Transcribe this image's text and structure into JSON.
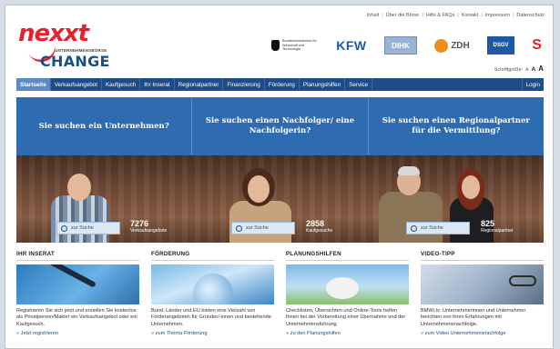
{
  "logo": {
    "brand_main": "nexxt",
    "brand_sub": "UNTERNEHMENSBÖRSE",
    "brand_second": "CHANGE"
  },
  "meta_links": [
    "Inhalt",
    "Über die Börse",
    "Hilfe & FAQs",
    "Kontakt",
    "Impressum",
    "Datenschutz"
  ],
  "partners": {
    "bmwi": "Bundesministerium für Wirtschaft und Technologie",
    "kfw": "KFW",
    "dihk": "DIHK",
    "zdh": "ZDH",
    "dsgv": "DSGV",
    "sparkasse": "S"
  },
  "font_size": {
    "label": "Schriftgröße:",
    "options": [
      "A",
      "A",
      "A"
    ]
  },
  "nav": {
    "items": [
      "Startseite",
      "Verkaufsangebot",
      "Kaufgesuch",
      "Ihr Inserat",
      "Regionalpartner",
      "Finanzierung",
      "Förderung",
      "Planungshilfen",
      "Service"
    ],
    "login": "Login"
  },
  "hero": {
    "tabs": [
      "Sie suchen ein Unternehmen?",
      "Sie suchen einen Nachfolger/ eine Nachfolgerin?",
      "Sie suchen einen Regionalpartner für die Vermittlung?"
    ],
    "search_label": "zur Suche",
    "stats": [
      {
        "number": "7276",
        "label": "Verkaufsangebote"
      },
      {
        "number": "2858",
        "label": "Kaufgesuche"
      },
      {
        "number": "825",
        "label": "Regionalpartner"
      }
    ]
  },
  "teasers": [
    {
      "title": "Ihr Inserat",
      "text": "Registrieren Sie sich jetzt und erstellen Sie kostenlos als Privatperson/Makler ein Verkaufsangebot oder ein Kaufgesuch.",
      "link": "» Jetzt registrieren"
    },
    {
      "title": "Förderung",
      "text": "Bund, Länder und EU bieten eine Vielzahl von Förderangeboten für Gründer/-innen und bestehende Unternehmen.",
      "link": "» zum Thema Förderung"
    },
    {
      "title": "Planungshilfen",
      "text": "Checklisten, Übersichten und Online-Tools helfen Ihnen bei der Vorbereitung einer Übernahme und der Unternehmensführung.",
      "link": "» zu den Planungshilfen"
    },
    {
      "title": "Video-Tipp",
      "text": "BMWi.tv: Unternehmerinnen und Unternehmer berichten von ihren Erfahrungen mit Unternehmensnachfolge.",
      "link": "» zum Video Unternehmensnachfolge"
    }
  ],
  "colors": {
    "nav": "#1d4c86",
    "nav_active": "#5d8ac4",
    "hero_tab": "#2f6bb1",
    "brand_red": "#e8212c"
  }
}
